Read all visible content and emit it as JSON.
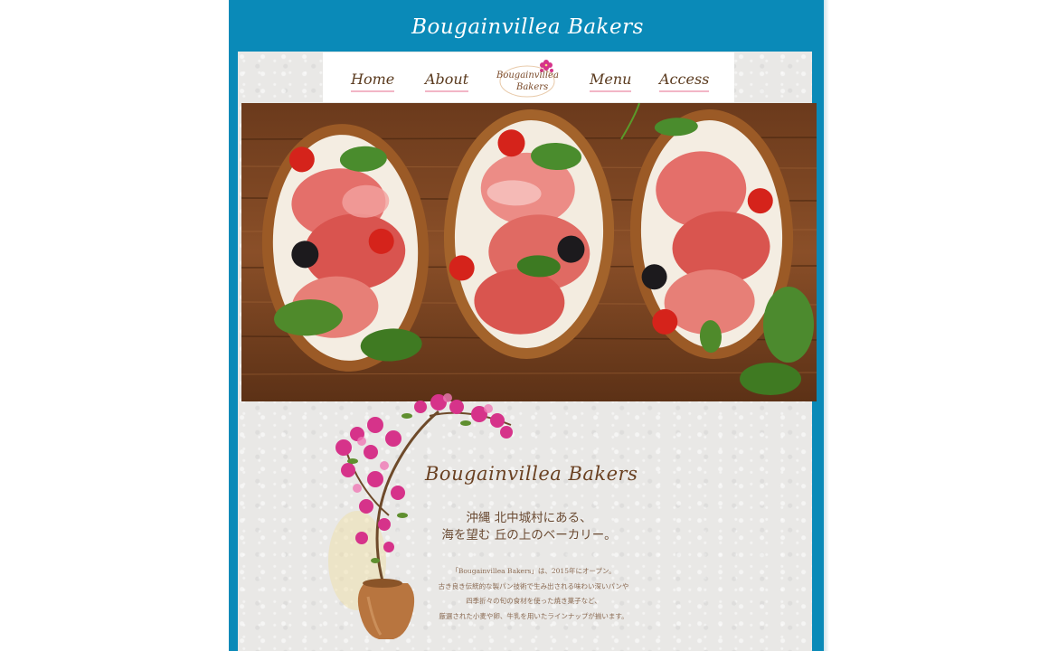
{
  "header": {
    "site_title": "Bougainvillea Bakers"
  },
  "nav": {
    "items": [
      {
        "label": "Home"
      },
      {
        "label": "About"
      },
      {
        "label": "Menu"
      },
      {
        "label": "Access"
      }
    ],
    "logo": {
      "line1": "Bougainvillea",
      "line2": "Bakers"
    }
  },
  "hero": {
    "image_icon": "bruschetta-photo"
  },
  "intro": {
    "title": "Bougainvillea Bakers",
    "lead_lines": [
      "沖縄 北中城村にある、",
      "海を望む 丘の上のベーカリー。"
    ],
    "body_lines": [
      "「Bougainvillea Bakers」は、2015年にオープン。",
      "古き良き伝統的な製パン技術で生み出される味わい深いパンや",
      "四季折々の旬の食材を使った焼き菓子など、",
      "厳選された小麦や卵、牛乳を用いたラインナップが揃います。"
    ]
  },
  "colors": {
    "frame_blue": "#0a8ab8",
    "nav_text": "#5a3a1e",
    "nav_underline": "#f2b6c6",
    "title_brown": "#6a4122",
    "flower_pink": "#d6338a"
  }
}
